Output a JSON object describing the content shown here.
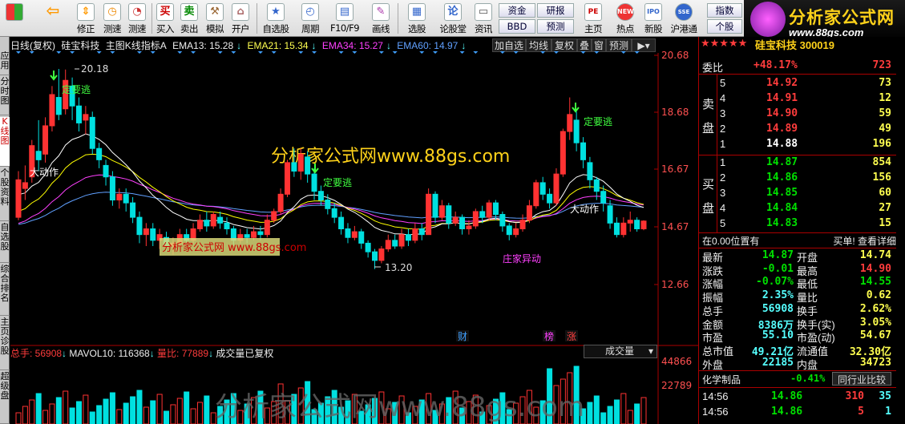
{
  "toolbar": {
    "buttons": [
      {
        "label": "",
        "icon": "grid-icon"
      },
      {
        "label": "",
        "icon": "back-arrow-icon"
      },
      {
        "label": "修正",
        "icon": "arrow-updown-icon"
      },
      {
        "label": "测速",
        "icon": "clock-icon"
      },
      {
        "label": "买入",
        "icon": "buy-icon",
        "glyph": "买"
      },
      {
        "label": "卖出",
        "icon": "sell-icon",
        "glyph": "卖"
      },
      {
        "label": "模拟",
        "icon": "hammer-icon"
      },
      {
        "label": "开户",
        "icon": "lock-icon"
      },
      {
        "label": "自选股",
        "icon": "star-board-icon"
      },
      {
        "label": "周期",
        "icon": "clock-cycle-icon"
      },
      {
        "label": "F10/F9",
        "icon": "f10-icon"
      },
      {
        "label": "画线",
        "icon": "pen-icon"
      },
      {
        "label": "选股",
        "icon": "select-icon"
      },
      {
        "label": "论股堂",
        "icon": "forum-icon",
        "glyph": "论"
      },
      {
        "label": "资讯",
        "icon": "news-icon"
      }
    ],
    "small_buttons": [
      "资金",
      "研报",
      "BBD",
      "预测"
    ],
    "right_buttons": [
      {
        "label": "主页",
        "icon": "pe-icon",
        "glyph": "PE"
      },
      {
        "label": "热点",
        "icon": "hot-icon",
        "glyph": "NEW"
      },
      {
        "label": "新股",
        "icon": "ipo-icon",
        "glyph": "IPO"
      },
      {
        "label": "沪港通",
        "icon": "hk-icon",
        "glyph": "SSE"
      }
    ],
    "index_buttons": [
      "指数",
      "个股"
    ],
    "logo": {
      "title": "分析家公式网",
      "url": "www.88gs.com"
    }
  },
  "left_tabs": [
    "应用",
    "分时图",
    "K线图",
    "个股资料",
    "自选股",
    "综合排名",
    "主页诊股",
    "超级盘"
  ],
  "chart_header": {
    "period": "日线(复权)",
    "stock_name": "硅宝科技",
    "indicator": "主图K线指标A",
    "ema13": "EMA13: 15.28",
    "ema21": "EMA21: 15.34",
    "ema34": "EMA34: 15.27",
    "ema60": "EMA60: 14.97"
  },
  "chart_tabs": [
    "加自选",
    "均线",
    "复权",
    "叠",
    "窗",
    "预测"
  ],
  "chart_data": {
    "type": "candlestick",
    "y_axis": [
      "20.68",
      "18.68",
      "16.67",
      "14.67",
      "12.66"
    ],
    "annotations": [
      "20.18",
      "13.20",
      "定要逃",
      "定要逃",
      "定要逃",
      "大动作",
      "大动作",
      "庄家异动"
    ],
    "watermark": "分析家公式网www.88gs.com",
    "badge": "分析家公式网 www.88gs.com",
    "event_markers": [
      "财",
      "榜",
      "涨"
    ]
  },
  "volume_header": {
    "total": "总手: 56908",
    "mavol": "MAVOL10: 116368",
    "ratio": "量比: 77889",
    "note": "成交量已复权",
    "dropdown": "成交量",
    "y_axis": [
      "44866",
      "22789"
    ],
    "watermark": "分析家公式网www.88gs.com"
  },
  "right_panel": {
    "title": "硅宝科技 300019",
    "webi_label": "委比",
    "webi_value": "+48.17%",
    "webi_diff": "723",
    "sell_label": "卖盘",
    "buy_label": "买盘",
    "asks": [
      [
        "5",
        "14.92",
        "73"
      ],
      [
        "4",
        "14.91",
        "12"
      ],
      [
        "3",
        "14.90",
        "59"
      ],
      [
        "2",
        "14.89",
        "49"
      ],
      [
        "1",
        "14.88",
        "196"
      ]
    ],
    "bids": [
      [
        "1",
        "14.87",
        "854"
      ],
      [
        "2",
        "14.86",
        "156"
      ],
      [
        "3",
        "14.85",
        "60"
      ],
      [
        "4",
        "14.84",
        "27"
      ],
      [
        "5",
        "14.83",
        "15"
      ]
    ],
    "position_label": "在0.00位置有",
    "order_detail": "买单! 查看详细",
    "stats": [
      [
        "最新",
        "14.87",
        "开盘",
        "14.74"
      ],
      [
        "涨跌",
        "-0.01",
        "最高",
        "14.90"
      ],
      [
        "涨幅",
        "-0.07%",
        "最低",
        "14.55"
      ],
      [
        "振幅",
        "2.35%",
        "量比",
        "0.62"
      ],
      [
        "总手",
        "56908",
        "换手",
        "2.62%"
      ],
      [
        "金额",
        "8386万",
        "换手(实)",
        "3.05%"
      ],
      [
        "市盈",
        "55.10",
        "市盈(动)",
        "54.67"
      ],
      [
        "总市值",
        "49.21亿",
        "流通值",
        "32.30亿"
      ],
      [
        "外盘",
        "22185",
        "内盘",
        "34723"
      ]
    ],
    "sector": "化学制品",
    "sector_change": "-0.41%",
    "sector_btn": "同行业比较",
    "ticks": [
      [
        "14:56",
        "14.86",
        "310",
        "35"
      ],
      [
        "14:56",
        "14.86",
        "5",
        "1"
      ]
    ]
  },
  "colors": {
    "up": "#ff3232",
    "down": "#00e0e0",
    "ema13": "#ffffff",
    "ema21": "#ffff00",
    "ema34": "#ff40ff",
    "ema60": "#60a0ff"
  }
}
